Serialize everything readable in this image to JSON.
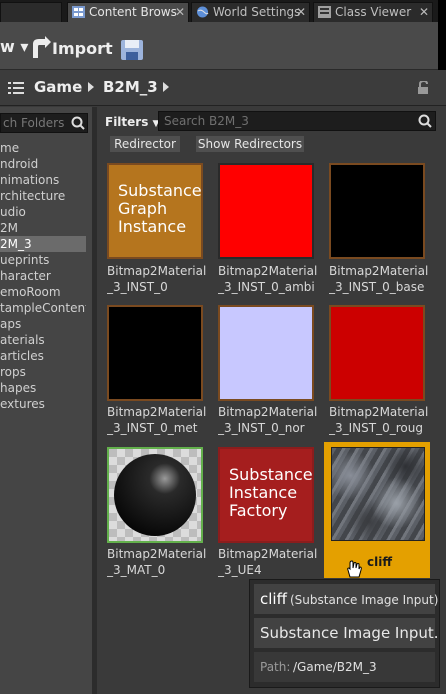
{
  "tabs": [
    {
      "label": "Content Brows",
      "icon": "content-browser-icon"
    },
    {
      "label": "World Settings",
      "icon": "globe-icon"
    },
    {
      "label": "Class Viewer",
      "icon": "class-viewer-icon"
    }
  ],
  "toolbar": {
    "add_new_label": "w ▾",
    "import_label": "Import",
    "save_icon": "save-icon"
  },
  "breadcrumb": {
    "items": [
      "Game",
      "B2M_3"
    ]
  },
  "sidebar": {
    "search_placeholder": "ch Folders",
    "items": [
      "me",
      "ndroid",
      "nimations",
      "rchitecture",
      "udio",
      "2M",
      "2M_3",
      "ueprints",
      "haracter",
      "emoRoom",
      "tampleContent",
      "aps",
      "aterials",
      "articles",
      "rops",
      "hapes",
      "extures"
    ],
    "selected_index": 6
  },
  "filter_bar": {
    "filters_label": "Filters",
    "search_placeholder": "Search B2M_3",
    "chips": [
      "Redirector",
      "Show Redirectors"
    ]
  },
  "assets": [
    {
      "label": "Bitmap2Material\n_3_INST_0",
      "thumb_text": "Substance\nGraph\nInstance",
      "color": "#b5751e"
    },
    {
      "label": "Bitmap2Material\n_3_INST_0_ambi",
      "thumb_text": "",
      "color": "#ff0000"
    },
    {
      "label": "Bitmap2Material\n_3_INST_0_base",
      "thumb_text": "",
      "color": "#000000"
    },
    {
      "label": "Bitmap2Material\n_3_INST_0_met",
      "thumb_text": "",
      "color": "#000000"
    },
    {
      "label": "Bitmap2Material\n_3_INST_0_nor",
      "thumb_text": "",
      "color": "#c8c8ff"
    },
    {
      "label": "Bitmap2Material\n_3_INST_0_roug",
      "thumb_text": "",
      "color": "#cc0000"
    },
    {
      "label": "Bitmap2Material\n_3_MAT_0",
      "thumb_text": "",
      "color": "#d0d0d0"
    },
    {
      "label": "Bitmap2Material\n_3_UE4",
      "thumb_text": "Substance\nInstance\nFactory",
      "color": "#a51e1e"
    },
    {
      "label": "cliff",
      "thumb_text": "",
      "color": "#e4a000"
    }
  ],
  "tooltip": {
    "name": "cliff",
    "type": "(Substance Image Input)",
    "class_name": "Substance Image Input.",
    "path_label": "Path:",
    "path_value": "/Game/B2M_3"
  }
}
